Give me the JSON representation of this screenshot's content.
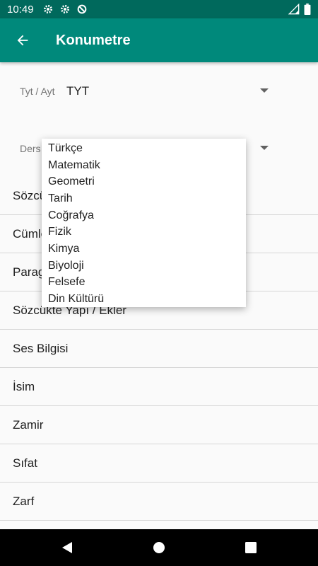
{
  "status_bar": {
    "time": "10:49",
    "left_icons": [
      "settings-icon",
      "settings-icon",
      "sync-blocked-icon"
    ],
    "right_icons": [
      "signal-icon",
      "battery-icon"
    ]
  },
  "app_bar": {
    "title": "Konumetre",
    "back_icon": "arrow-left-icon",
    "color": "#00897b"
  },
  "form": {
    "exam_label": "Tyt / Ayt",
    "exam_value": "TYT",
    "course_label": "Ders"
  },
  "topics": [
    "Sözcükte Anlam",
    "Cümlede Anlam",
    "Paragraf",
    "Sözcükte Yapı / Ekler",
    "Ses Bilgisi",
    "İsim",
    "Zamir",
    "Sıfat",
    "Zarf"
  ],
  "course_dropdown": {
    "options": [
      "Türkçe",
      "Matematik",
      "Geometri",
      "Tarih",
      "Coğrafya",
      "Fizik",
      "Kimya",
      "Biyoloji",
      "Felsefe",
      "Din Kültürü"
    ]
  },
  "nav_bar": {
    "buttons": [
      "back-triangle-icon",
      "home-circle-icon",
      "recents-square-icon"
    ]
  }
}
